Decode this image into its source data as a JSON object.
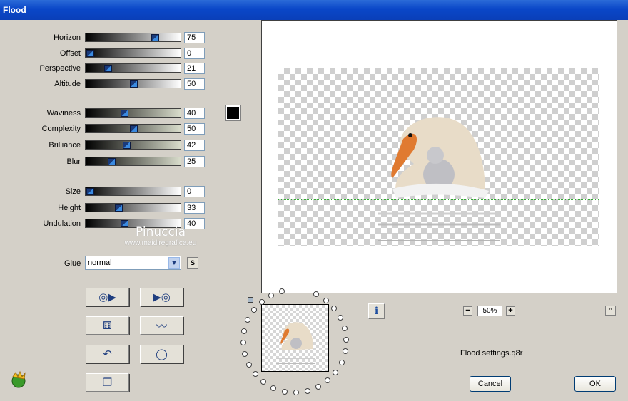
{
  "window": {
    "title": "Flood"
  },
  "params": [
    {
      "label": "Horizon",
      "value": "75",
      "level": 0.75,
      "track": "bw"
    },
    {
      "label": "Offset",
      "value": "0",
      "level": 0,
      "track": "bw"
    },
    {
      "label": "Perspective",
      "value": "21",
      "level": 0.21,
      "track": "bw"
    },
    {
      "label": "Altitude",
      "value": "50",
      "level": 0.5,
      "track": "bw"
    },
    {
      "label": "Waviness",
      "value": "40",
      "level": 0.4,
      "track": "bsg"
    },
    {
      "label": "Complexity",
      "value": "50",
      "level": 0.5,
      "track": "bsg"
    },
    {
      "label": "Brilliance",
      "value": "42",
      "level": 0.42,
      "track": "bsg"
    },
    {
      "label": "Blur",
      "value": "25",
      "level": 0.25,
      "track": "bsg"
    },
    {
      "label": "Size",
      "value": "0",
      "level": 0,
      "track": "bw"
    },
    {
      "label": "Height",
      "value": "33",
      "level": 0.33,
      "track": "bw"
    },
    {
      "label": "Undulation",
      "value": "40",
      "level": 0.4,
      "track": "bw"
    }
  ],
  "color": {
    "swatch": "#000000"
  },
  "glue": {
    "label": "Glue",
    "value": "normal",
    "s_label": "S"
  },
  "watermark": {
    "title": "Pinuccia",
    "url": "www.maidiregrafica.eu"
  },
  "preview": {
    "info_label": "i",
    "zoom_minus": "−",
    "zoom": "50%",
    "zoom_plus": "+",
    "collapse": "^",
    "settings_file": "Flood settings.q8r"
  },
  "buttons": {
    "cancel": "Cancel",
    "ok": "OK"
  },
  "tools": [
    {
      "name": "previous-preset-button",
      "icon": "disc-arrow-left-icon",
      "glyph": "◎▶"
    },
    {
      "name": "next-preset-button",
      "icon": "arrow-disc-right-icon",
      "glyph": "▶◎"
    },
    {
      "name": "randomize-button",
      "icon": "dice-icon",
      "glyph": "⚅"
    },
    {
      "name": "wave-button",
      "icon": "wave-icon",
      "glyph": "〰"
    },
    {
      "name": "undo-button",
      "icon": "undo-icon",
      "glyph": "↶"
    },
    {
      "name": "reset-button",
      "icon": "ring-icon",
      "glyph": "◯"
    },
    {
      "name": "copy-button",
      "icon": "copy-icon",
      "glyph": "❐"
    }
  ]
}
